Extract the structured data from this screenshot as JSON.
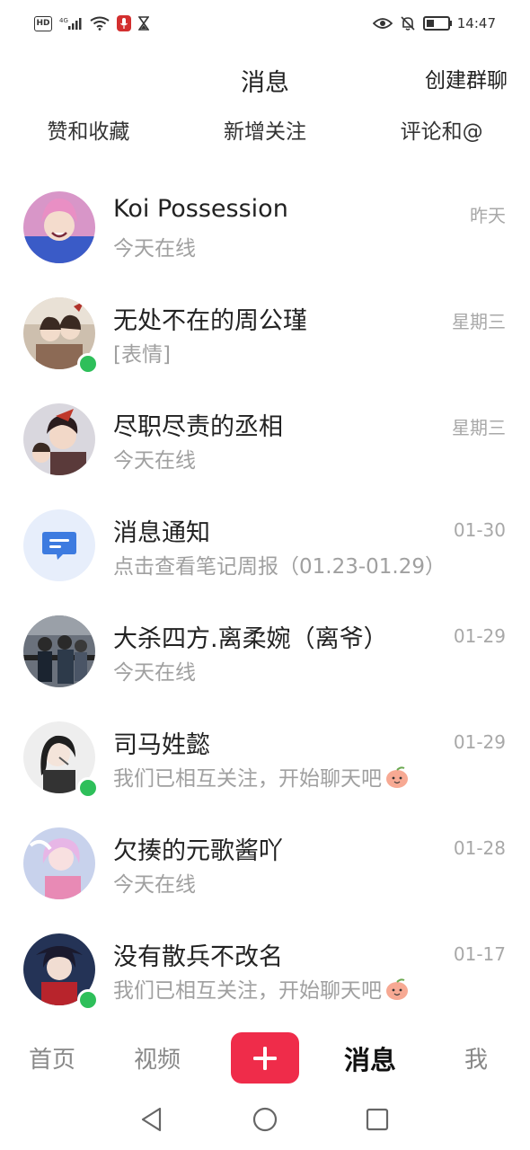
{
  "status_bar": {
    "hd": "HD",
    "network": "4G",
    "time": "14:47"
  },
  "header": {
    "title": "消息",
    "action": "创建群聊"
  },
  "quick_tabs": [
    "赞和收藏",
    "新增关注",
    "评论和@"
  ],
  "messages": [
    {
      "name": "Koi Possession",
      "preview": "今天在线",
      "time": "昨天",
      "online": false,
      "avatar_color": "#d896c8"
    },
    {
      "name": "无处不在的周公瑾",
      "preview": "[表情]",
      "time": "星期三",
      "online": true,
      "avatar_color": "#8c6a55"
    },
    {
      "name": "尽职尽责的丞相",
      "preview": "今天在线",
      "time": "星期三",
      "online": false,
      "avatar_color": "#7a4a4a"
    },
    {
      "name": "消息通知",
      "preview": "点击查看笔记周报（01.23-01.29）",
      "time": "01-30",
      "online": false,
      "avatar_color": "#e7eefb"
    },
    {
      "name": "大杀四方.离柔婉（离爷）",
      "preview": "今天在线",
      "time": "01-29",
      "online": false,
      "avatar_color": "#3d4450"
    },
    {
      "name": "司马姓懿",
      "preview": "我们已相互关注，开始聊天吧",
      "time": "01-29",
      "online": true,
      "avatar_color": "#e3e3e3"
    },
    {
      "name": "欠揍的元歌酱吖",
      "preview": "今天在线",
      "time": "01-28",
      "online": false,
      "avatar_color": "#c8d2ec"
    },
    {
      "name": "没有散兵不改名",
      "preview": "我们已相互关注，开始聊天吧",
      "time": "01-17",
      "online": true,
      "avatar_color": "#2a3550"
    }
  ],
  "bottom_nav": {
    "home": "首页",
    "video": "视频",
    "messages": "消息",
    "me": "我"
  },
  "colors": {
    "accent": "#ef2c4a",
    "online": "#2ebf5a",
    "notice_icon": "#3d7be0"
  }
}
